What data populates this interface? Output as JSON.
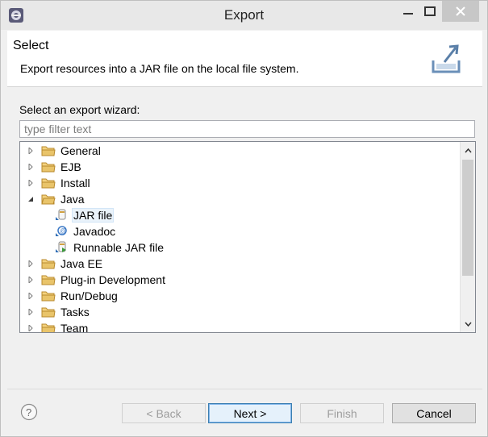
{
  "window": {
    "title": "Export",
    "app_icon": "eclipse-app-icon"
  },
  "banner": {
    "title": "Select",
    "description": "Export resources into a JAR file on the local file system.",
    "icon": "export-wizard-banner-icon"
  },
  "wizard": {
    "label": "Select an export wizard:",
    "filter_placeholder": "type filter text",
    "filter_value": ""
  },
  "tree": {
    "items": [
      {
        "label": "General",
        "level": 0,
        "expanded": false,
        "icon": "folder-icon"
      },
      {
        "label": "EJB",
        "level": 0,
        "expanded": false,
        "icon": "folder-icon"
      },
      {
        "label": "Install",
        "level": 0,
        "expanded": false,
        "icon": "folder-icon"
      },
      {
        "label": "Java",
        "level": 0,
        "expanded": true,
        "icon": "folder-icon"
      },
      {
        "label": "JAR file",
        "level": 1,
        "selected": true,
        "icon": "jar-file-icon"
      },
      {
        "label": "Javadoc",
        "level": 1,
        "icon": "javadoc-icon"
      },
      {
        "label": "Runnable JAR file",
        "level": 1,
        "icon": "runnable-jar-icon"
      },
      {
        "label": "Java EE",
        "level": 0,
        "expanded": false,
        "icon": "folder-icon"
      },
      {
        "label": "Plug-in Development",
        "level": 0,
        "expanded": false,
        "icon": "folder-icon"
      },
      {
        "label": "Run/Debug",
        "level": 0,
        "expanded": false,
        "icon": "folder-icon"
      },
      {
        "label": "Tasks",
        "level": 0,
        "expanded": false,
        "icon": "folder-icon"
      },
      {
        "label": "Team",
        "level": 0,
        "expanded": false,
        "icon": "folder-icon"
      }
    ]
  },
  "buttons": {
    "back": "< Back",
    "next": "Next >",
    "finish": "Finish",
    "cancel": "Cancel"
  },
  "colors": {
    "folder": "#e9c46a",
    "selection": "#eaf3fb",
    "default_button_border": "#3c7fb1"
  }
}
